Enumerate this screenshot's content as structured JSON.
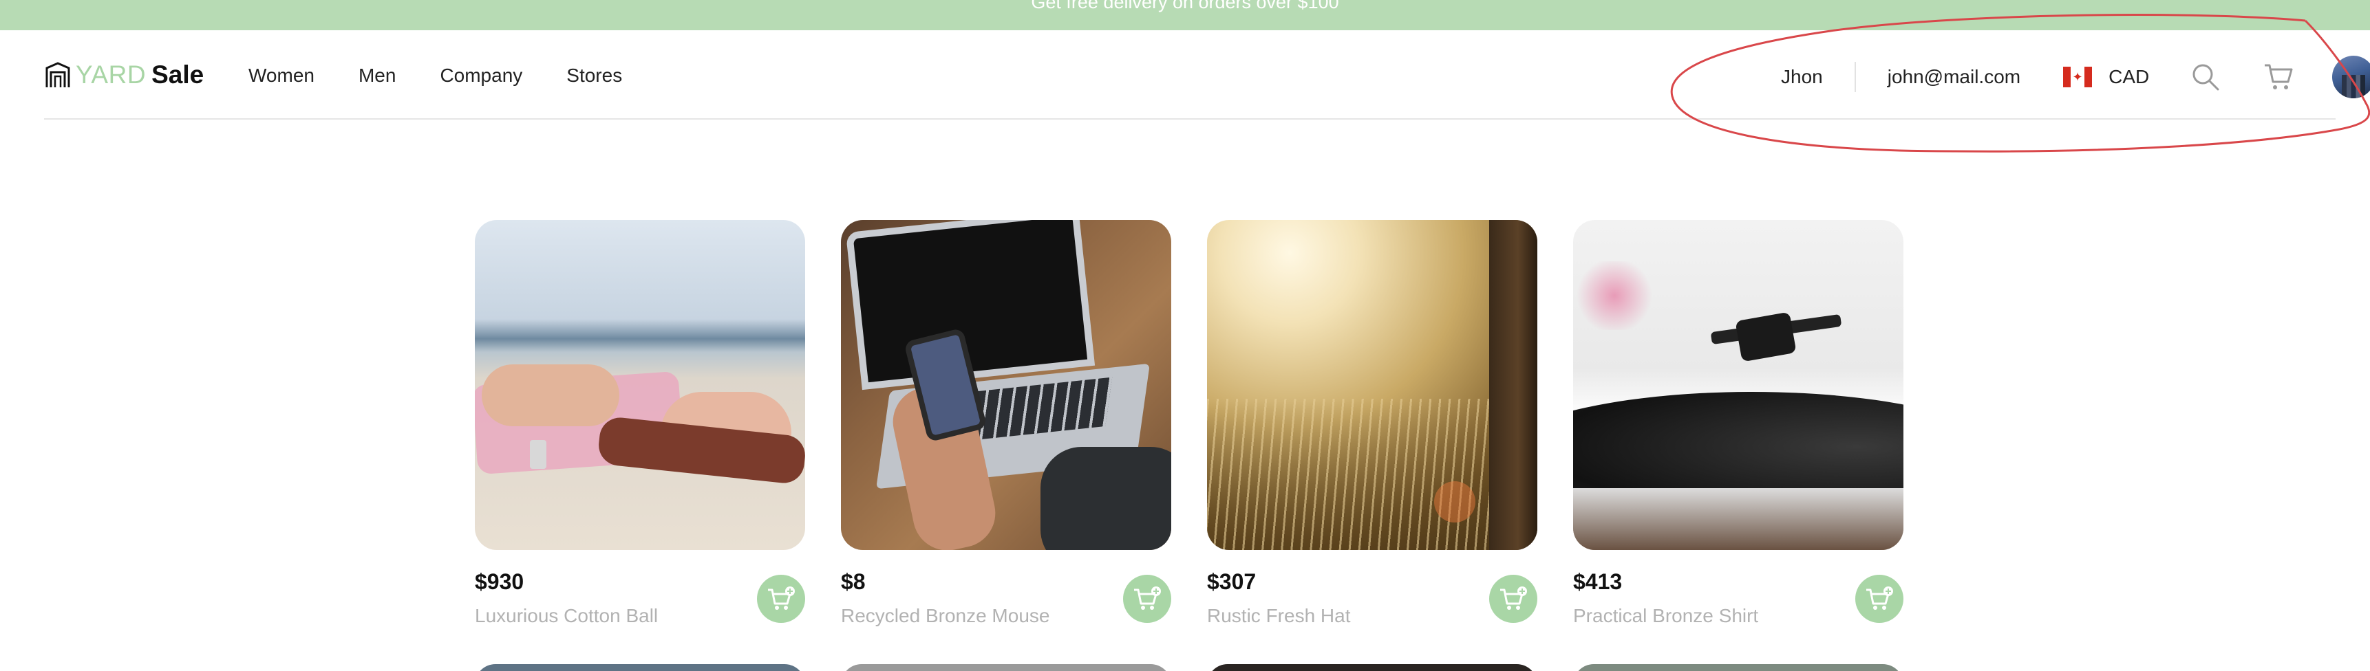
{
  "promo": {
    "text": "Get free delivery on orders over $100"
  },
  "brand": {
    "part1": "YARD",
    "part2": "Sale"
  },
  "nav": {
    "links": [
      "Women",
      "Men",
      "Company",
      "Stores"
    ]
  },
  "account": {
    "name": "Jhon",
    "email": "john@mail.com",
    "currency": "CAD",
    "flag": "canada-flag-icon"
  },
  "icons": {
    "search": "search-icon",
    "cart": "cart-icon",
    "add_to_cart": "add-to-cart-icon"
  },
  "colors": {
    "accent": "#a9d6a6",
    "promo_bg": "#b7dbb4",
    "annotation": "#d9474a"
  },
  "products": [
    {
      "price": "$930",
      "name": "Luxurious Cotton Ball",
      "image": "beach-photo"
    },
    {
      "price": "$8",
      "name": "Recycled Bronze Mouse",
      "image": "laptop-phone-photo"
    },
    {
      "price": "$307",
      "name": "Rustic Fresh Hat",
      "image": "sunlit-field-photo"
    },
    {
      "price": "$413",
      "name": "Practical Bronze Shirt",
      "image": "record-player-photo"
    }
  ]
}
